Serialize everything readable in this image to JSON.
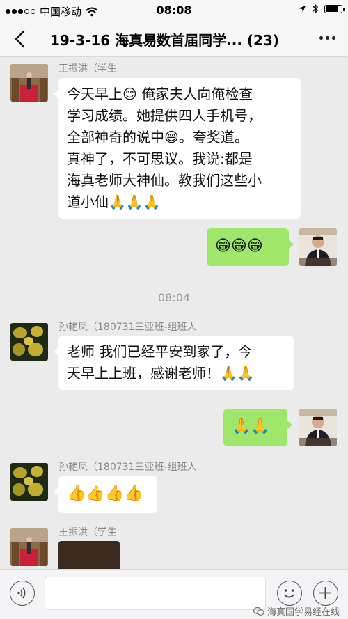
{
  "status_bar": {
    "carrier": "中国移动",
    "time": "08:08"
  },
  "nav": {
    "title": "19-3-16 海真易数首届同学... (23)"
  },
  "messages": [
    {
      "sender": "王振洪（学生",
      "side": "left",
      "lines": [
        "今天早上😊 俺家夫人向俺检查",
        "学习成绩。她提供四人手机号，",
        "全部神奇的说中😄。夸奖道。",
        "真神了，不可思议。我说:都是",
        "海真老师大神仙。教我们这些小",
        "道小仙🙏🙏🙏"
      ]
    },
    {
      "side": "right",
      "text": "😁😁😁"
    },
    {
      "sender": "孙艳凤（180731三亚班-组班人",
      "side": "left",
      "lines": [
        "老师 我们已经平安到家了，今",
        "天早上上班，感谢老师！🙏🙏"
      ]
    },
    {
      "side": "right",
      "text": "🙏🙏"
    },
    {
      "sender": "孙艳凤（180731三亚班-组班人",
      "side": "left",
      "text": "👍👍👍👍"
    },
    {
      "sender": "王振洪（学生",
      "side": "left",
      "text": ""
    }
  ],
  "time_separator": "08:04",
  "input": {
    "placeholder": ""
  },
  "watermark": "海真国学易经在线",
  "colors": {
    "background": "#ebebeb",
    "outgoing_bubble": "#9fe76b",
    "incoming_bubble": "#ffffff"
  }
}
